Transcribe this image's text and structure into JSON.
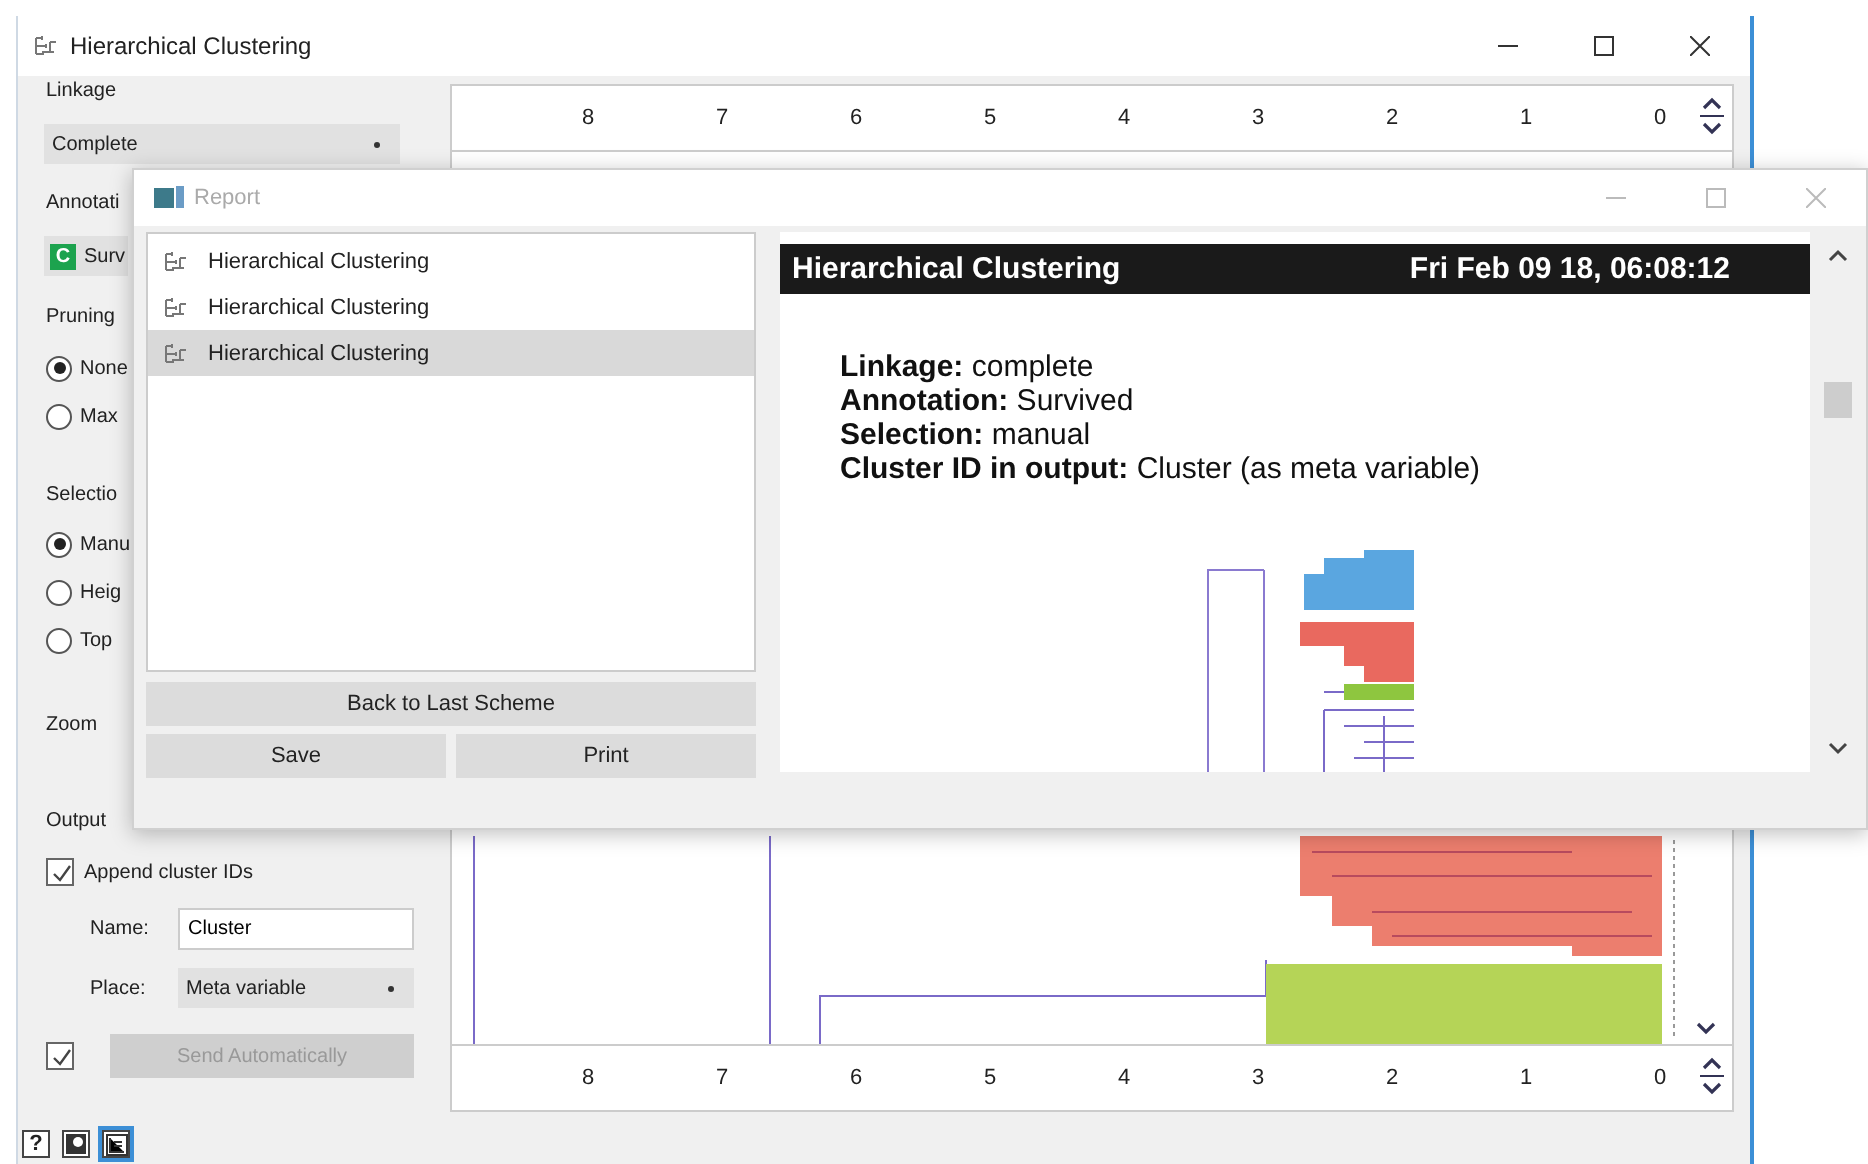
{
  "main_window": {
    "title": "Hierarchical Clustering",
    "linkage": {
      "label": "Linkage",
      "value": "Complete"
    },
    "annotation": {
      "label": "Annotati",
      "icon_letter": "C",
      "value": "Surv"
    },
    "pruning": {
      "label": "Pruning",
      "options": [
        {
          "label": "None",
          "selected": true
        },
        {
          "label": "Max",
          "selected": false
        }
      ]
    },
    "selection": {
      "label": "Selectio",
      "options": [
        {
          "label": "Manu",
          "selected": true
        },
        {
          "label": "Heig",
          "selected": false
        },
        {
          "label": "Top",
          "selected": false
        }
      ]
    },
    "zoom": {
      "label": "Zoom"
    },
    "output": {
      "label": "Output",
      "append_cluster_ids": {
        "label": "Append cluster IDs",
        "checked": true
      },
      "name": {
        "label": "Name:",
        "value": "Cluster"
      },
      "place": {
        "label": "Place:",
        "value": "Meta variable"
      }
    },
    "send": {
      "checked": true,
      "label": "Send Automatically",
      "disabled": true
    },
    "top_axis_ticks": [
      "8",
      "7",
      "6",
      "5",
      "4",
      "3",
      "2",
      "1",
      "0"
    ],
    "bottom_axis_ticks": [
      "8",
      "7",
      "6",
      "5",
      "4",
      "3",
      "2",
      "1",
      "0"
    ],
    "status_bar": [
      {
        "kind": "help",
        "label": "?",
        "selected": false
      },
      {
        "kind": "image",
        "selected": false
      },
      {
        "kind": "report",
        "selected": true
      }
    ]
  },
  "report_window": {
    "title": "Report",
    "items": [
      {
        "label": "Hierarchical Clustering",
        "selected": false
      },
      {
        "label": "Hierarchical Clustering",
        "selected": false
      },
      {
        "label": "Hierarchical Clustering",
        "selected": true
      }
    ],
    "buttons": {
      "back": "Back to Last Scheme",
      "save": "Save",
      "print": "Print"
    },
    "header": {
      "title": "Hierarchical Clustering",
      "date": "Fri Feb 09 18, 06:08:12"
    },
    "lines": [
      "**Linkage:** complete",
      "**Annotation:** Survived",
      "**Selection:** manual",
      "**Cluster ID in output:** Cluster (as meta variable)"
    ]
  }
}
